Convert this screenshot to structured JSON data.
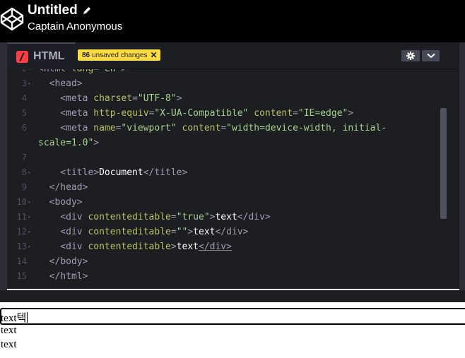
{
  "header": {
    "title": "Untitled",
    "author": "Captain Anonymous"
  },
  "editor": {
    "tab_label": "HTML",
    "unsaved_count": "86",
    "unsaved_label": "unsaved changes",
    "close_symbol": "✕",
    "lines": [
      {
        "num": "2",
        "fold": "▾",
        "parts": [
          [
            "t",
            "<html "
          ],
          [
            "a",
            "lang"
          ],
          [
            "t",
            "="
          ],
          [
            "s",
            "\"en\""
          ],
          [
            "t",
            ">"
          ]
        ]
      },
      {
        "num": "3",
        "fold": "▾",
        "parts": [
          [
            "t",
            "  <head>"
          ]
        ]
      },
      {
        "num": "4",
        "fold": "",
        "parts": [
          [
            "t",
            "    <meta "
          ],
          [
            "a",
            "charset"
          ],
          [
            "t",
            "="
          ],
          [
            "s",
            "\"UTF-8\""
          ],
          [
            "t",
            ">"
          ]
        ]
      },
      {
        "num": "5",
        "fold": "",
        "parts": [
          [
            "t",
            "    <meta "
          ],
          [
            "a",
            "http-equiv"
          ],
          [
            "t",
            "="
          ],
          [
            "s",
            "\"X-UA-Compatible\""
          ],
          [
            "t",
            " "
          ],
          [
            "a",
            "content"
          ],
          [
            "t",
            "="
          ],
          [
            "s",
            "\"IE=edge\""
          ],
          [
            "t",
            ">"
          ]
        ]
      },
      {
        "num": "6",
        "fold": "",
        "parts": [
          [
            "t",
            "    <meta "
          ],
          [
            "a",
            "name"
          ],
          [
            "t",
            "="
          ],
          [
            "s",
            "\"viewport\""
          ],
          [
            "t",
            " "
          ],
          [
            "a",
            "content"
          ],
          [
            "t",
            "="
          ],
          [
            "s",
            "\"width=device-width, initial-"
          ]
        ]
      },
      {
        "num": "",
        "fold": "",
        "parts": [
          [
            "s",
            "scale=1.0\""
          ],
          [
            "t",
            ">"
          ]
        ]
      },
      {
        "num": "7",
        "fold": "",
        "parts": []
      },
      {
        "num": "8",
        "fold": "▾",
        "parts": [
          [
            "t",
            "    <title>"
          ],
          [
            "w",
            "Document"
          ],
          [
            "t",
            "</title>"
          ]
        ]
      },
      {
        "num": "9",
        "fold": "",
        "parts": [
          [
            "t",
            "  </head>"
          ]
        ]
      },
      {
        "num": "10",
        "fold": "▾",
        "parts": [
          [
            "t",
            "  <body>"
          ]
        ]
      },
      {
        "num": "11",
        "fold": "▾",
        "parts": [
          [
            "t",
            "    <div "
          ],
          [
            "a",
            "contenteditable"
          ],
          [
            "t",
            "="
          ],
          [
            "s",
            "\"true\""
          ],
          [
            "t",
            ">"
          ],
          [
            "w",
            "text"
          ],
          [
            "t",
            "</div>"
          ]
        ]
      },
      {
        "num": "12",
        "fold": "▾",
        "parts": [
          [
            "t",
            "    <div "
          ],
          [
            "a",
            "contenteditable"
          ],
          [
            "t",
            "="
          ],
          [
            "s",
            "\"\""
          ],
          [
            "t",
            ">"
          ],
          [
            "w",
            "text"
          ],
          [
            "t",
            "</div>"
          ]
        ]
      },
      {
        "num": "13",
        "fold": "▾",
        "parts": [
          [
            "t",
            "    <div "
          ],
          [
            "a",
            "contenteditable"
          ],
          [
            "t",
            ">"
          ],
          [
            "w",
            "text"
          ],
          [
            "tu",
            "</div>"
          ]
        ]
      },
      {
        "num": "14",
        "fold": "",
        "parts": [
          [
            "t",
            "  </body>"
          ]
        ]
      },
      {
        "num": "15",
        "fold": "",
        "parts": [
          [
            "t",
            "  </html>"
          ]
        ]
      }
    ]
  },
  "preview": {
    "line1": "text텍",
    "line2": "text",
    "line3": "text"
  },
  "colors": {
    "accent_red": "#ff3c41",
    "badge_yellow": "#ffdd40",
    "editor_bg": "#1d1e22"
  },
  "icons": [
    "codepen-logo-icon",
    "pencil-icon",
    "html-tab-icon",
    "close-icon",
    "gear-icon",
    "chevron-down-icon"
  ]
}
